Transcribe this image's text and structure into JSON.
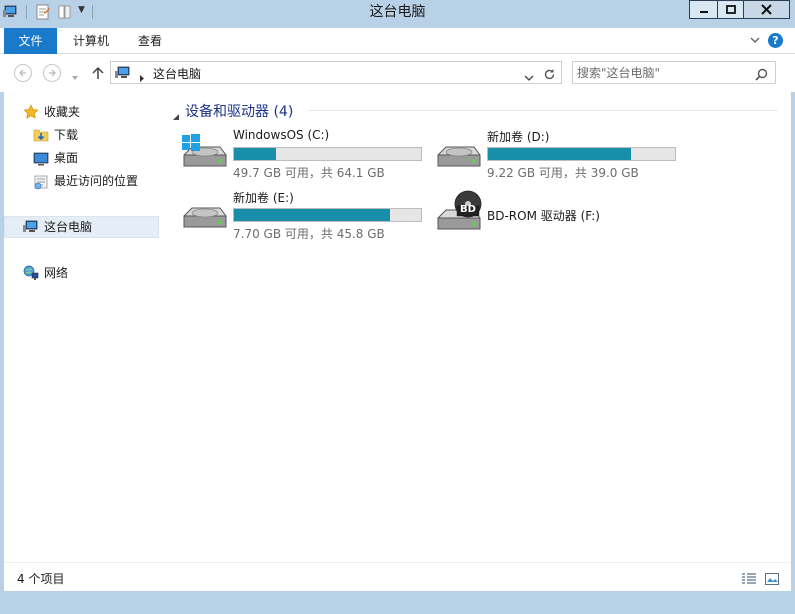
{
  "window": {
    "title": "这台电脑"
  },
  "ribbon": {
    "tabs": [
      {
        "label": "文件"
      },
      {
        "label": "计算机"
      },
      {
        "label": "查看"
      }
    ]
  },
  "address": {
    "path": "这台电脑",
    "search_placeholder": "搜索\"这台电脑\""
  },
  "navpane": {
    "favorites_label": "收藏夹",
    "items": [
      {
        "label": "下载"
      },
      {
        "label": "桌面"
      },
      {
        "label": "最近访问的位置"
      }
    ],
    "thispc_label": "这台电脑",
    "network_label": "网络"
  },
  "content": {
    "group_title": "设备和驱动器 (4)",
    "drives": [
      {
        "name": "WindowsOS (C:)",
        "info": "49.7 GB 可用，共 64.1 GB",
        "used_fraction": 0.225
      },
      {
        "name": "新加卷 (D:)",
        "info": "9.22 GB 可用，共 39.0 GB",
        "used_fraction": 0.764
      },
      {
        "name": "新加卷 (E:)",
        "info": "7.70 GB 可用，共 45.8 GB",
        "used_fraction": 0.832
      },
      {
        "name": "BD-ROM 驱动器 (F:)",
        "bd_label": "BD"
      }
    ]
  },
  "statusbar": {
    "item_count": "4 个项目"
  },
  "colors": {
    "accent": "#1979ca",
    "bar_fill": "#198eab",
    "group_header": "#1e3287"
  }
}
